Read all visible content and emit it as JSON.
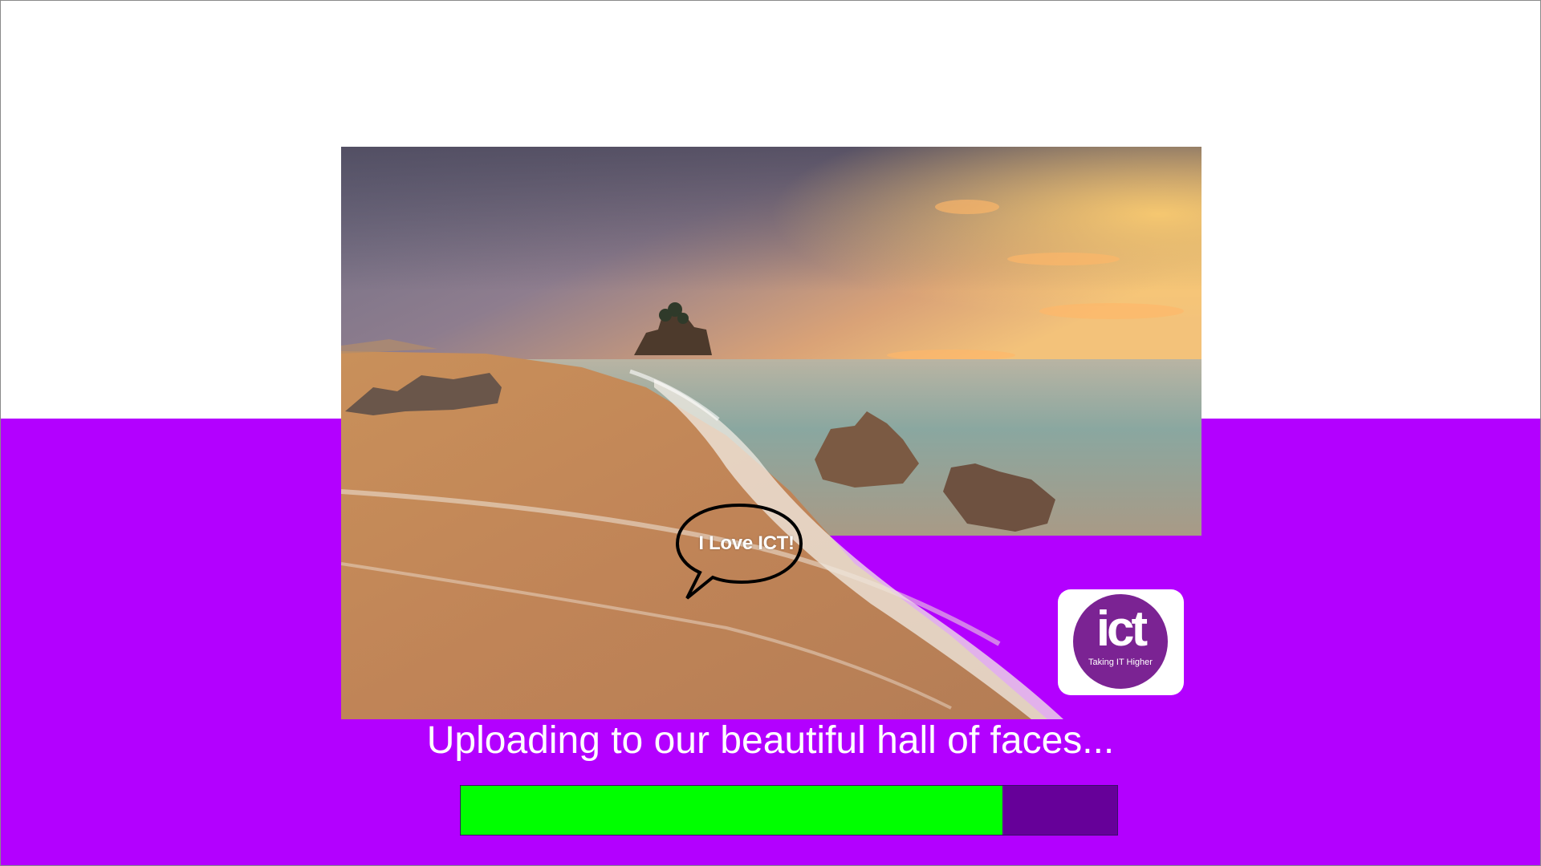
{
  "colors": {
    "background_bottom": "#b300ff",
    "background_top": "#ffffff",
    "progress_fill": "#00ff00",
    "progress_track": "#660099",
    "logo_purple": "#7b2393"
  },
  "photo": {
    "speech_bubble_text": "I Love ICT!",
    "logo": {
      "wordmark": "ict",
      "tagline": "Taking IT Higher"
    }
  },
  "upload": {
    "status_text": "Uploading to our beautiful hall of faces...",
    "progress_fraction": 0.825
  }
}
